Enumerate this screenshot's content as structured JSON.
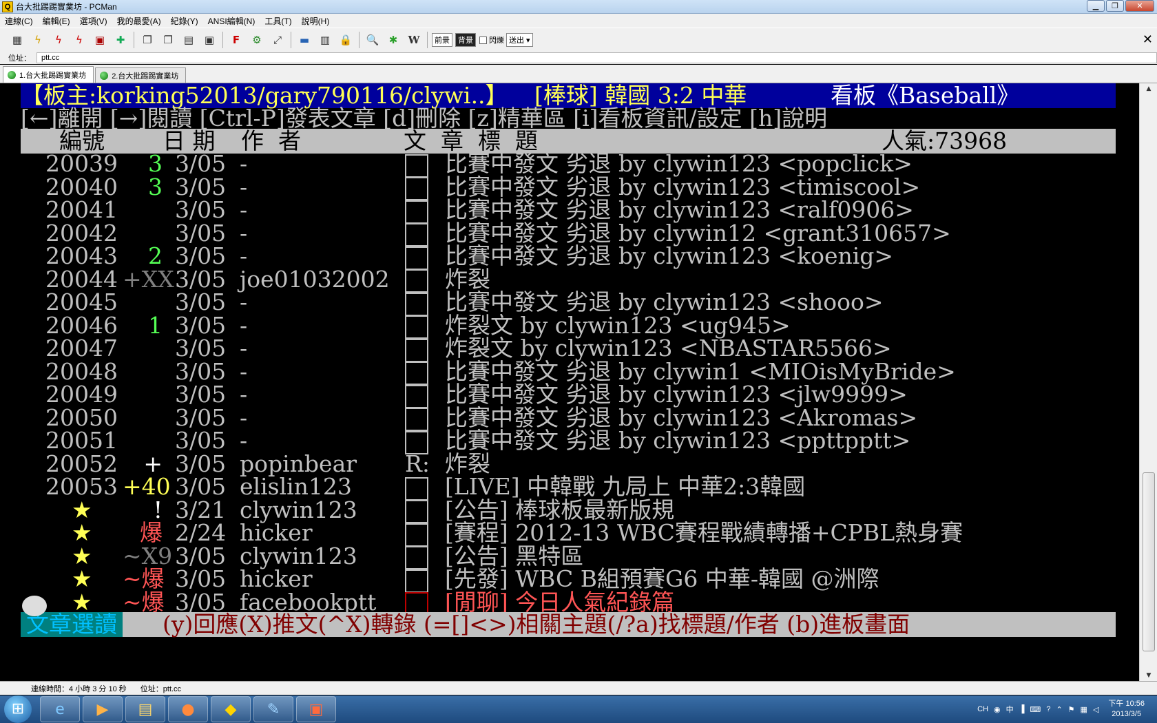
{
  "window": {
    "title": "台大批踢踢實業坊 - PCMan",
    "app_icon_glyph": "Q"
  },
  "menu": [
    "連線(C)",
    "編輯(E)",
    "選項(V)",
    "我的最愛(A)",
    "紀錄(Y)",
    "ANSI編輯(N)",
    "工具(T)",
    "說明(H)"
  ],
  "toolbar": {
    "fg_label": "前景",
    "bg_label": "背景",
    "blink_label": "閃爍",
    "send_label": "送出"
  },
  "address": {
    "label": "位址：",
    "value": "ptt.cc"
  },
  "tabs": [
    "1.台大批踢踢實業坊",
    "2.台大批踢踢實業坊"
  ],
  "header": {
    "moderators": "【板主:korking52013/gary790116/clywi..】",
    "board_title": "[棒球] 韓國 3:2 中華",
    "board_name": "看板《Baseball》"
  },
  "help_line": "[←]離開 [→]閱讀 [Ctrl-P]發表文章 [d]刪除 [z]精華區 [i]看板資訊/設定 [h]說明",
  "columns": {
    "num": "編號",
    "date": "日 期",
    "author": "作  者",
    "title": "文  章  標  題",
    "popularity": "人氣:73968"
  },
  "posts": [
    {
      "num": "20039",
      "push": "3",
      "push_color": "green",
      "date": "3/05",
      "author": "-",
      "mark": "box",
      "title": "比賽中發文 劣退 by clywin123 <popclick>"
    },
    {
      "num": "20040",
      "push": "3",
      "push_color": "green",
      "date": "3/05",
      "author": "-",
      "mark": "box",
      "title": "比賽中發文 劣退 by clywin123 <timiscool>"
    },
    {
      "num": "20041",
      "push": "",
      "push_color": "",
      "date": "3/05",
      "author": "-",
      "mark": "box",
      "title": "比賽中發文 劣退 by clywin123 <ralf0906>"
    },
    {
      "num": "20042",
      "push": "",
      "push_color": "",
      "date": "3/05",
      "author": "-",
      "mark": "box",
      "title": "比賽中發文 劣退 by clywin12 <grant310657>"
    },
    {
      "num": "20043",
      "push": "2",
      "push_color": "green",
      "date": "3/05",
      "author": "-",
      "mark": "box",
      "title": "比賽中發文 劣退 by clywin123 <koenig>"
    },
    {
      "num": "20044",
      "push": "+XX",
      "push_color": "grey",
      "date": "3/05",
      "author": "joe01032002",
      "mark": "box",
      "title": "炸裂"
    },
    {
      "num": "20045",
      "push": "",
      "push_color": "",
      "date": "3/05",
      "author": "-",
      "mark": "box",
      "title": "比賽中發文 劣退 by clywin123 <shooo>"
    },
    {
      "num": "20046",
      "push": "1",
      "push_color": "green",
      "date": "3/05",
      "author": "-",
      "mark": "box",
      "title": "炸裂文 by clywin123 <ug945>"
    },
    {
      "num": "20047",
      "push": "",
      "push_color": "",
      "date": "3/05",
      "author": "-",
      "mark": "box",
      "title": "炸裂文 by clywin123 <NBASTAR5566>"
    },
    {
      "num": "20048",
      "push": "",
      "push_color": "",
      "date": "3/05",
      "author": "-",
      "mark": "box",
      "title": "比賽中發文 劣退 by clywin1 <MIOisMyBride>"
    },
    {
      "num": "20049",
      "push": "",
      "push_color": "",
      "date": "3/05",
      "author": "-",
      "mark": "box",
      "title": "比賽中發文 劣退 by clywin123 <jlw9999>"
    },
    {
      "num": "20050",
      "push": "",
      "push_color": "",
      "date": "3/05",
      "author": "-",
      "mark": "box",
      "title": "比賽中發文 劣退 by clywin123 <Akromas>"
    },
    {
      "num": "20051",
      "push": "",
      "push_color": "",
      "date": "3/05",
      "author": "-",
      "mark": "box",
      "title": "比賽中發文 劣退 by clywin123 <ppttpptt>"
    },
    {
      "num": "20052",
      "push": "+",
      "push_color": "white",
      "date": "3/05",
      "author": "popinbear",
      "mark": "R:",
      "title": "炸裂"
    },
    {
      "num": "20053",
      "push": "+40",
      "push_color": "yellow",
      "date": "3/05",
      "author": "elislin123",
      "mark": "box",
      "title": "[LIVE] 中韓戰 九局上 中華2:3韓國"
    },
    {
      "num": "★",
      "push": "!",
      "push_color": "white",
      "date": "3/21",
      "author": "clywin123",
      "mark": "box",
      "title": "[公告] 棒球板最新版規"
    },
    {
      "num": "★",
      "push": "爆",
      "push_color": "red",
      "date": "2/24",
      "author": "hicker",
      "mark": "box",
      "title": "[賽程] 2012-13 WBC賽程戰績轉播+CPBL熱身賽"
    },
    {
      "num": "★",
      "push": "~X9",
      "push_color": "grey",
      "date": "3/05",
      "author": "clywin123",
      "mark": "box",
      "title": "[公告] 黑特區"
    },
    {
      "num": "★",
      "push": "~爆",
      "push_color": "red",
      "date": "3/05",
      "author": "hicker",
      "mark": "box",
      "title": "[先發] WBC B組預賽G6 中華-韓國 @洲際"
    },
    {
      "num": "★",
      "push": "~爆",
      "push_color": "red",
      "date": "3/05",
      "author": "facebookptt",
      "mark": "box",
      "title": "[閒聊] 今日人氣紀錄篇",
      "title_color": "red"
    }
  ],
  "footer": {
    "tag": "文章選讀",
    "keys": "(y)回應(X)推文(^X)轉錄 (=[]<>)相關主題(/?a)找標題/作者 (b)進板畫面"
  },
  "status": {
    "connection_time": "連線時間：4 小時 3 分 10 秒",
    "address": "位址：ptt.cc"
  },
  "tray": {
    "lang": "CH",
    "ime": "中",
    "time_line1": "下午 10:56",
    "time_line2": "2013/3/5"
  },
  "colors": {
    "header_bg": "#00009c",
    "header_fg": "#ffff55",
    "bar_grey": "#c0c0c0",
    "push_green": "#55ff55",
    "push_red": "#ff5555",
    "push_yellow": "#ffff55"
  }
}
